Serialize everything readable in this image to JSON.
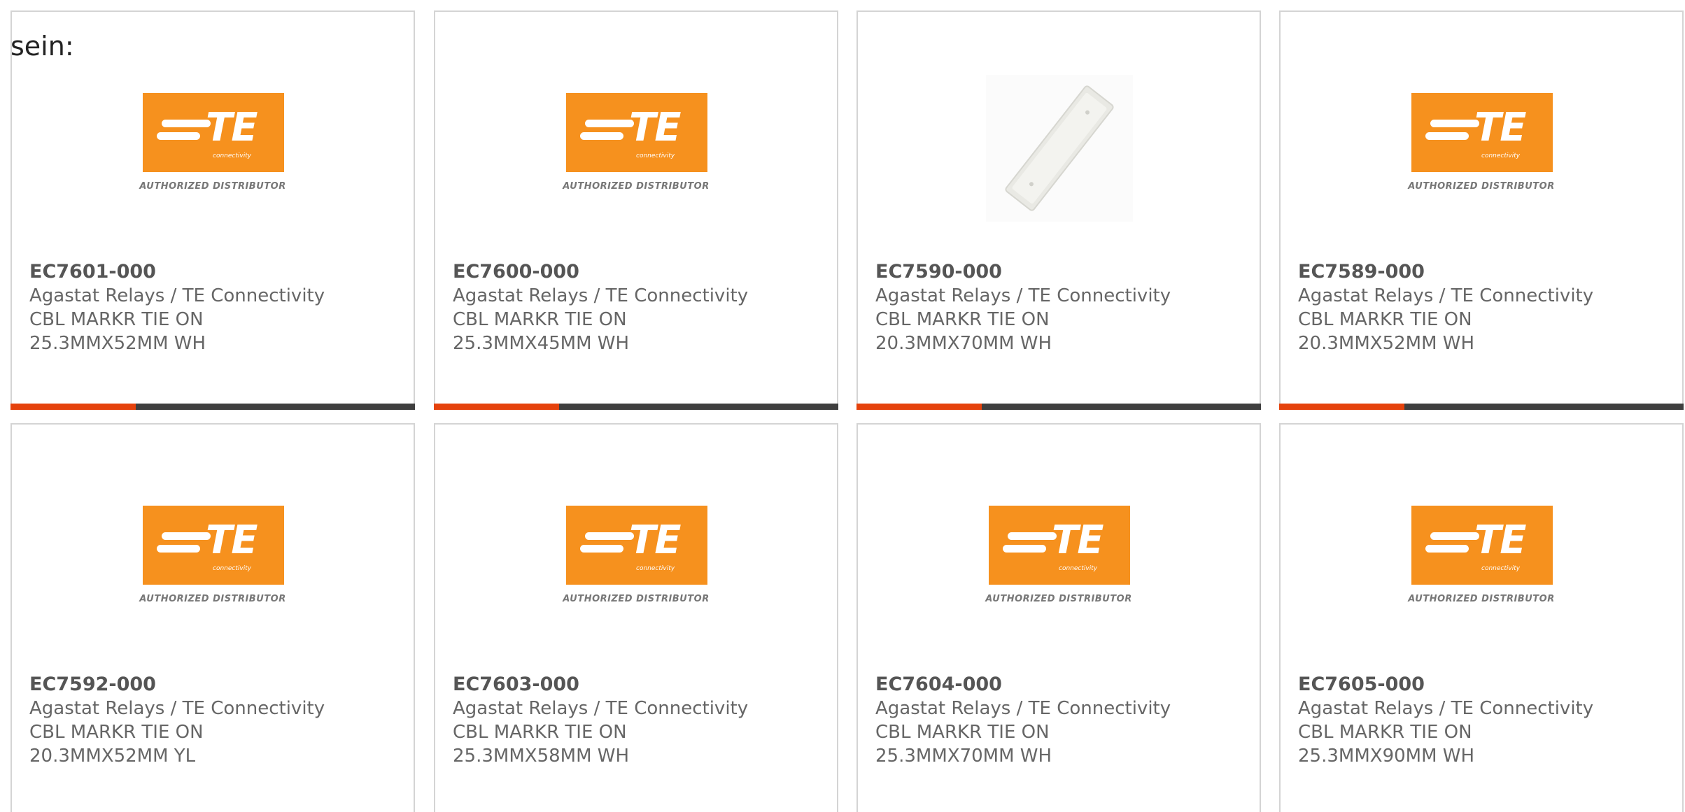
{
  "intro_text": "sein:",
  "logo": {
    "letters": "TE",
    "subtitle": "connectivity",
    "caption": "AUTHORIZED DISTRIBUTOR",
    "color": "#f6911e"
  },
  "progress_colors": {
    "fill": "#e5420c",
    "track": "#3f3f3f"
  },
  "products": [
    {
      "part": "EC7601-000",
      "manufacturer": "Agastat Relays / TE Connectivity",
      "desc1": "CBL MARKR TIE ON",
      "desc2": "25.3MMX52MM WH",
      "image": "te-logo",
      "progress": 0.31
    },
    {
      "part": "EC7600-000",
      "manufacturer": "Agastat Relays / TE Connectivity",
      "desc1": "CBL MARKR TIE ON",
      "desc2": "25.3MMX45MM WH",
      "image": "te-logo",
      "progress": 0.31
    },
    {
      "part": "EC7590-000",
      "manufacturer": "Agastat Relays / TE Connectivity",
      "desc1": "CBL MARKR TIE ON",
      "desc2": "20.3MMX70MM WH",
      "image": "product-photo",
      "progress": 0.31
    },
    {
      "part": "EC7589-000",
      "manufacturer": "Agastat Relays / TE Connectivity",
      "desc1": "CBL MARKR TIE ON",
      "desc2": "20.3MMX52MM WH",
      "image": "te-logo",
      "progress": 0.31
    },
    {
      "part": "EC7592-000",
      "manufacturer": "Agastat Relays / TE Connectivity",
      "desc1": "CBL MARKR TIE ON",
      "desc2": "20.3MMX52MM YL",
      "image": "te-logo"
    },
    {
      "part": "EC7603-000",
      "manufacturer": "Agastat Relays / TE Connectivity",
      "desc1": "CBL MARKR TIE ON",
      "desc2": "25.3MMX58MM WH",
      "image": "te-logo"
    },
    {
      "part": "EC7604-000",
      "manufacturer": "Agastat Relays / TE Connectivity",
      "desc1": "CBL MARKR TIE ON",
      "desc2": "25.3MMX70MM WH",
      "image": "te-logo"
    },
    {
      "part": "EC7605-000",
      "manufacturer": "Agastat Relays / TE Connectivity",
      "desc1": "CBL MARKR TIE ON",
      "desc2": "25.3MMX90MM WH",
      "image": "te-logo"
    }
  ]
}
